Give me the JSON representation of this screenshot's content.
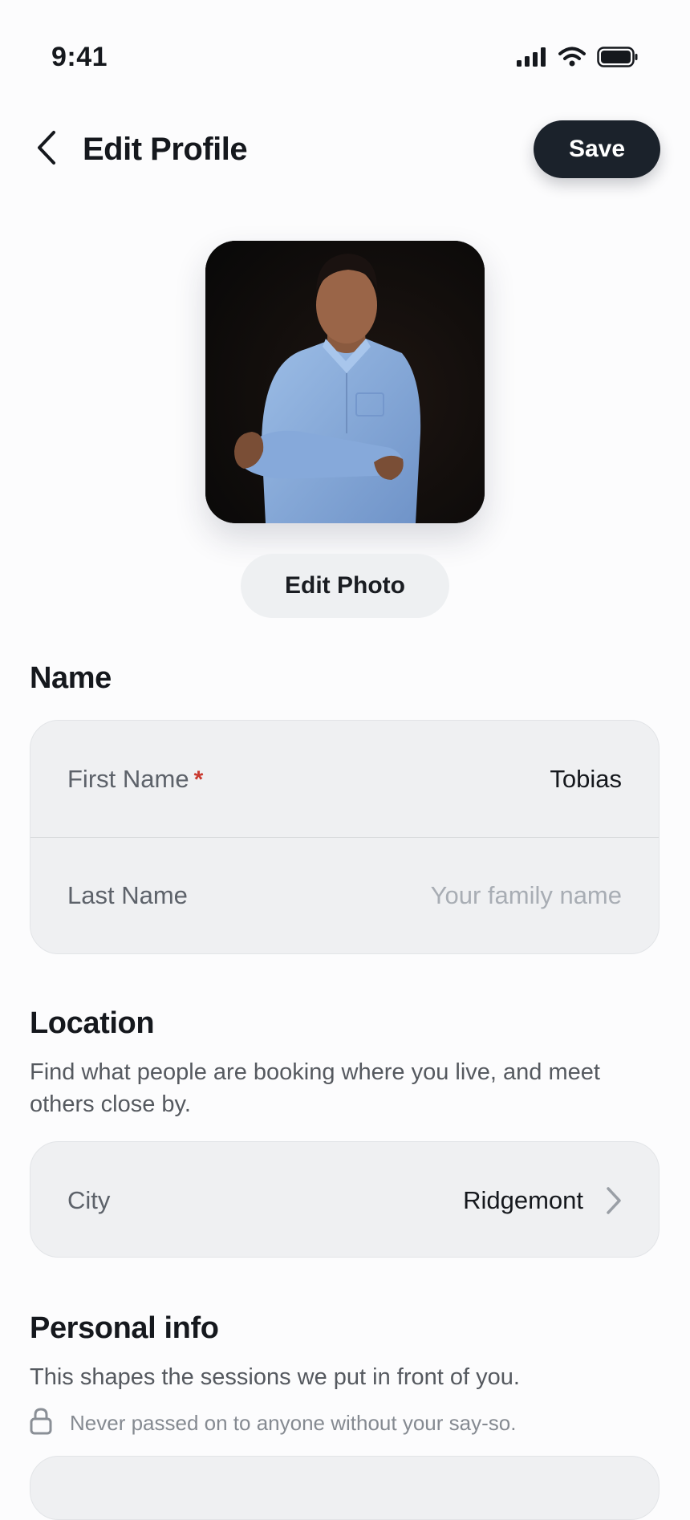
{
  "status_bar": {
    "time": "9:41"
  },
  "header": {
    "title": "Edit Profile",
    "save_label": "Save"
  },
  "photo": {
    "edit_label": "Edit Photo"
  },
  "name_section": {
    "title": "Name",
    "first_name": {
      "label": "First Name",
      "required_mark": "*",
      "value": "Tobias"
    },
    "last_name": {
      "label": "Last Name",
      "placeholder": "Your family name"
    }
  },
  "location_section": {
    "title": "Location",
    "description": "Find what people are booking where you live, and meet others close by.",
    "city": {
      "label": "City",
      "value": "Ridgemont"
    }
  },
  "personal_section": {
    "title": "Personal info",
    "description": "This shapes the sessions we put in front of you.",
    "privacy_note": "Never passed on to anyone without your say-so."
  },
  "icons": [
    "signal-icon",
    "wifi-icon",
    "battery-icon",
    "back-chevron-icon",
    "chevron-right-icon",
    "lock-icon"
  ],
  "colors": {
    "accent_dark": "#1b222b",
    "required": "#c9392f",
    "card_bg": "#eff0f2"
  }
}
